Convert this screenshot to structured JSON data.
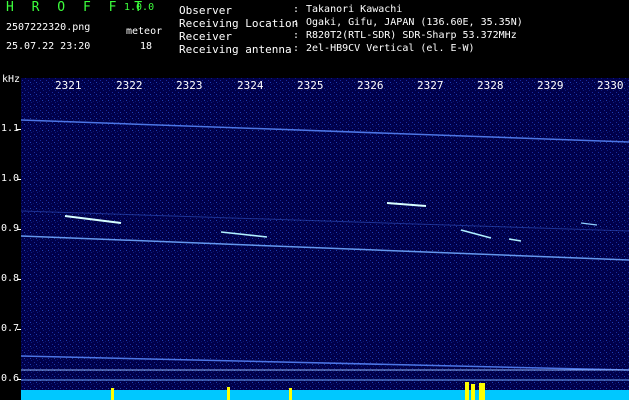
{
  "header": {
    "logo": "H R O F F T",
    "version": "1.0.0",
    "filename": "2507222320.png",
    "datetime": "25.07.22 23:20",
    "meteor_label": "meteor",
    "meteor_count": "18"
  },
  "info": {
    "rows": [
      {
        "label": "Observer",
        "sep": ":",
        "value": "Takanori Kawachi"
      },
      {
        "label": "Receiving Location",
        "sep": ":",
        "value": "Ogaki, Gifu, JAPAN (136.60E, 35.35N)"
      },
      {
        "label": "Receiver",
        "sep": ":",
        "value": "R820T2(RTL-SDR) SDR-Sharp 53.372MHz"
      },
      {
        "label": "Receiving antenna",
        "sep": ":",
        "value": "2el-HB9CV Vertical (el. E-W)"
      }
    ]
  },
  "axis": {
    "unit": "kHz",
    "x_ticks": [
      "2321",
      "2322",
      "2323",
      "2324",
      "2325",
      "2326",
      "2327",
      "2328",
      "2329",
      "2330"
    ],
    "y_ticks": [
      "1.1",
      "1.0",
      "0.9",
      "0.8",
      "0.7",
      "0.6"
    ]
  },
  "colors": {
    "background": "#000000",
    "spectrogram": "#00004a",
    "trace": "#6fa8ff",
    "meteor": "#d8ffff",
    "noise_floor": "#00e0ff",
    "noise_peak": "#ffff00",
    "logo": "#3cff3c"
  }
}
